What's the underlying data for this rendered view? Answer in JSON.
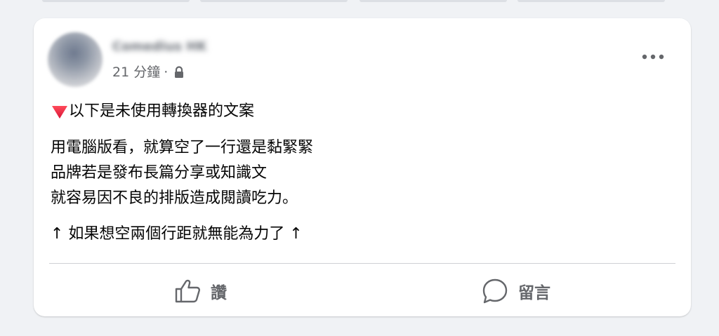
{
  "post": {
    "author_name": "Comedius HK",
    "time": "21 分鐘",
    "separator": "·",
    "privacy_icon": "lock-icon",
    "more_icon": "more-dots-icon",
    "lines": [
      "以下是未使用轉換器的文案",
      "用電腦版看，就算空了一行還是黏緊緊",
      "品牌若是發布長篇分享或知識文",
      "就容易因不良的排版造成閱讀吃力。",
      "↑ 如果想空兩個行距就無能為力了 ↑"
    ],
    "lead_icon": "red-down-triangle-icon"
  },
  "actions": {
    "like_label": "讚",
    "like_icon": "thumbs-up-icon",
    "comment_label": "留言",
    "comment_icon": "comment-bubble-icon"
  },
  "colors": {
    "background": "#f0f2f5",
    "card": "#ffffff",
    "text": "#050505",
    "secondary_text": "#65676b",
    "triangle": "#e0245e"
  }
}
